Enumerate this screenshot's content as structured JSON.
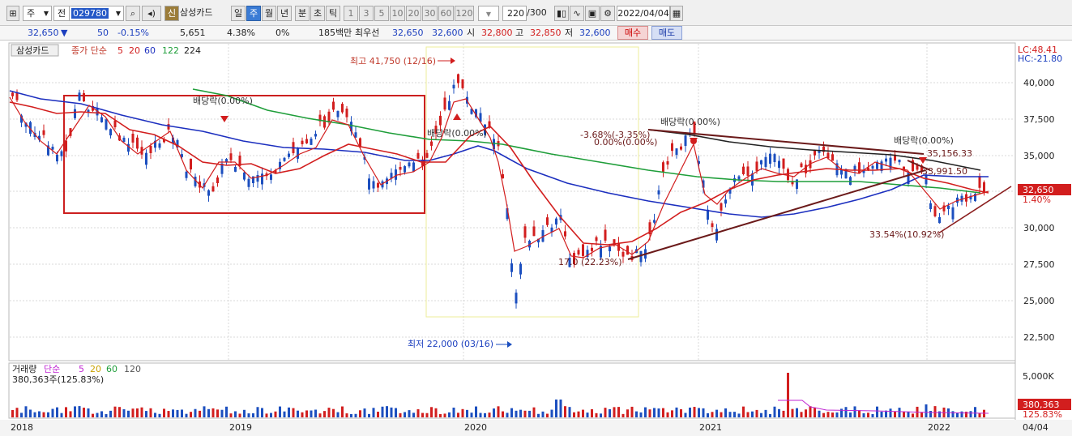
{
  "toolbar": {
    "mode": "주",
    "scope": "전",
    "code": "029780",
    "shin_label": "신",
    "stock_name": "삼성카드",
    "periods": [
      "일",
      "주",
      "월",
      "년"
    ],
    "intraday": [
      "분",
      "초",
      "틱"
    ],
    "intervals": [
      "1",
      "3",
      "5",
      "10",
      "20",
      "30",
      "60",
      "120"
    ],
    "count_display": "220",
    "count_total": "/300",
    "date": "2022/04/04"
  },
  "quote": {
    "price": "32,650",
    "change": "50",
    "change_pct": "-0.15%",
    "volume": "5,651",
    "turnover_pct": "4.38%",
    "zero_pct": "0%",
    "amount": "185백만",
    "best_label": "최우선",
    "ask": "32,650",
    "bid": "32,600",
    "open_label": "시",
    "open": "32,800",
    "high_label": "고",
    "high": "32,850",
    "low_label": "저",
    "low": "32,600",
    "buy_label": "매수",
    "sell_label": "매도"
  },
  "price_panel": {
    "name_tag": "삼성카드",
    "legend_prefix": "종가 단순",
    "ma_periods": [
      {
        "label": "5",
        "color": "#d21e1e"
      },
      {
        "label": "20",
        "color": "#d21e1e"
      },
      {
        "label": "60",
        "color": "#1c2fbf"
      },
      {
        "label": "122",
        "color": "#1f9e3a"
      },
      {
        "label": "224",
        "color": "#222222"
      }
    ],
    "lc_text": "LC:48.41",
    "hc_text": "HC:-21.80",
    "y_ticks": [
      "40,000",
      "37,500",
      "35,000",
      "30,000",
      "27,500",
      "25,000",
      "22,500"
    ],
    "current_price_label": "32,650",
    "current_pct_label": "1.40%",
    "annotations": {
      "high_mark": "최고 41,750 (12/16)",
      "low_mark": "최저 22,000 (03/16)",
      "div1": "배당락(0.00%)",
      "div2": "배당락(0.00%)",
      "div3": "배당락(0.00%)",
      "div4": "배당락(0.00%)",
      "fib1": "-3.68%(-3.35%)",
      "fib2": "0.00%(0.00%)",
      "fib3": "17.0 (22.23%)",
      "fib4": "33.54%(10.92%)",
      "value1": "35,156.33",
      "value2": "33,991.50"
    }
  },
  "volume_panel": {
    "title": "거래량",
    "legend_prefix": "단순",
    "ma_periods": [
      {
        "label": "5",
        "color": "#c026d3"
      },
      {
        "label": "20",
        "color": "#c9a100"
      },
      {
        "label": "60",
        "color": "#1f9e3a"
      },
      {
        "label": "120",
        "color": "#555555"
      }
    ],
    "summary": "380,363주(125.83%)",
    "y_tick": "5,000K",
    "current_volume_label": "380,363",
    "current_pct_label": "125.83%"
  },
  "x_axis": {
    "labels": [
      "2018",
      "2019",
      "2020",
      "2021",
      "2022"
    ],
    "right_date": "04/04"
  },
  "colors": {
    "up": "#d21e1e",
    "down": "#1c4fbf",
    "ma5": "#d21e1e",
    "ma60": "#1c2fbf",
    "ma122": "#1f9e3a",
    "ma224": "#222222",
    "trend": "#6b1a1a"
  }
}
